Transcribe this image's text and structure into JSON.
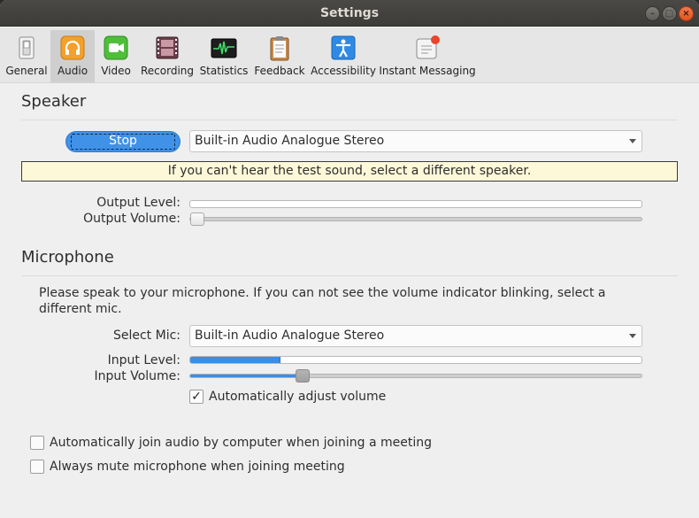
{
  "window": {
    "title": "Settings",
    "controls": [
      "minimize-icon",
      "maximize-icon",
      "close-icon"
    ]
  },
  "toolbar": {
    "tabs": [
      {
        "label": "General",
        "icon": "toggle-switch-icon",
        "active": false
      },
      {
        "label": "Audio",
        "icon": "headphones-icon",
        "active": true
      },
      {
        "label": "Video",
        "icon": "video-camera-icon",
        "active": false
      },
      {
        "label": "Recording",
        "icon": "film-strip-icon",
        "active": false
      },
      {
        "label": "Statistics",
        "icon": "waveform-monitor-icon",
        "active": false
      },
      {
        "label": "Feedback",
        "icon": "clipboard-icon",
        "active": false
      },
      {
        "label": "Accessibility",
        "icon": "accessibility-person-icon",
        "active": false
      },
      {
        "label": "Instant Messaging",
        "icon": "chat-notification-icon",
        "active": false
      }
    ]
  },
  "speaker": {
    "heading": "Speaker",
    "test_button": "Stop",
    "device": "Built-in Audio Analogue Stereo",
    "notice": "If you can't hear the test sound, select a different speaker.",
    "output_level_label": "Output Level:",
    "output_level": 0.0,
    "output_volume_label": "Output Volume:",
    "output_volume": 0.0
  },
  "microphone": {
    "heading": "Microphone",
    "instructions": "Please speak to your microphone. If you can not see the volume indicator blinking, select a different mic.",
    "select_label": "Select Mic:",
    "device": "Built-in Audio Analogue Stereo",
    "input_level_label": "Input Level:",
    "input_level": 0.2,
    "input_volume_label": "Input Volume:",
    "input_volume": 0.24,
    "auto_adjust_label": "Automatically adjust volume",
    "auto_adjust_checked": true,
    "check_mark": "✓"
  },
  "options": {
    "auto_join_label": "Automatically join audio by computer when joining a meeting",
    "auto_join_checked": false,
    "always_mute_label": "Always mute microphone when joining meeting",
    "always_mute_checked": false
  },
  "colors": {
    "accent": "#3a8ee6",
    "notice_bg": "#fdf8d8",
    "titlebar": "#3d3c39",
    "close_button": "#e3541e"
  }
}
